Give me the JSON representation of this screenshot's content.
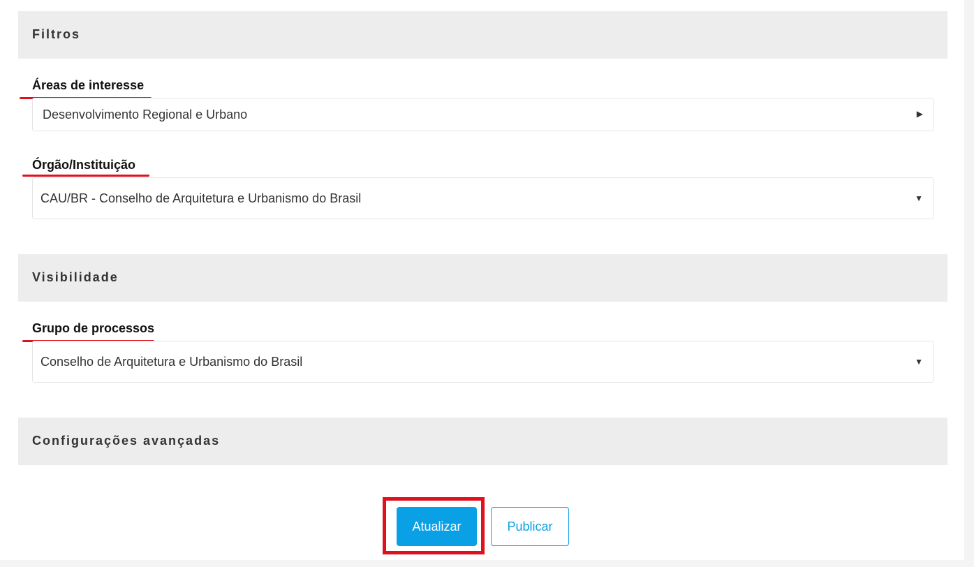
{
  "sections": {
    "filters_title": "Filtros",
    "visibility_title": "Visibilidade",
    "advanced_title": "Configurações avançadas"
  },
  "fields": {
    "areas": {
      "label": "Áreas de interesse",
      "value": "Desenvolvimento Regional e Urbano",
      "arrow": "right-caret-icon"
    },
    "orgao": {
      "label": "Órgão/Instituição",
      "value": "CAU/BR - Conselho de Arquitetura e Urbanismo do Brasil",
      "arrow": "down-caret-icon"
    },
    "grupo": {
      "label": "Grupo de processos",
      "value": "Conselho de Arquitetura e Urbanismo do Brasil",
      "arrow": "down-caret-icon"
    }
  },
  "actions": {
    "update_label": "Atualizar",
    "publish_label": "Publicar"
  },
  "colors": {
    "accent": "#0aa0e6",
    "annotation": "#e0101c",
    "section_bg": "#ededed"
  }
}
